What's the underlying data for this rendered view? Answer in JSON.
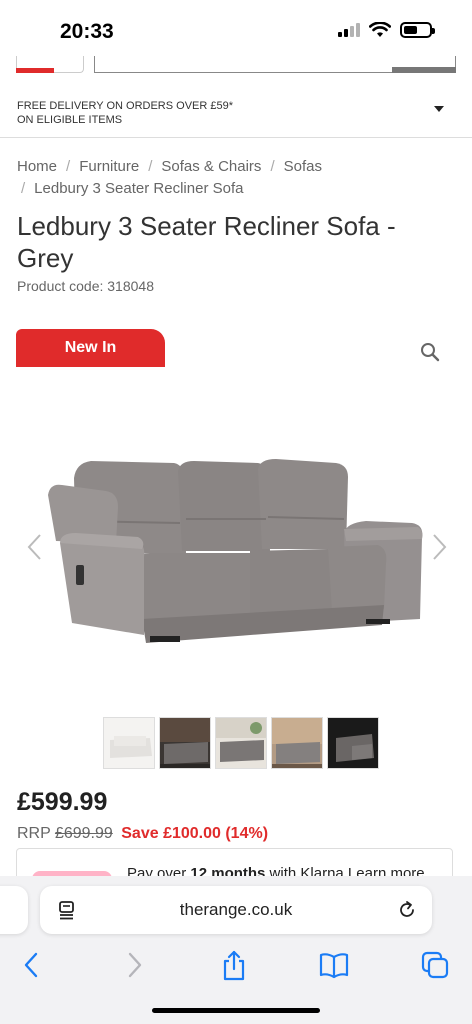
{
  "status_bar": {
    "time": "20:33"
  },
  "header": {},
  "delivery_banner": {
    "line1": "FREE DELIVERY ON ORDERS OVER £59*",
    "line2": "ON ELIGIBLE ITEMS"
  },
  "breadcrumb": {
    "items": [
      "Home",
      "Furniture",
      "Sofas & Chairs",
      "Sofas"
    ],
    "current": "Ledbury 3 Seater Recliner Sofa",
    "separator": "/"
  },
  "product": {
    "title": "Ledbury 3 Seater Recliner Sofa - Grey",
    "code": "Product code: 318048",
    "badge": "New In",
    "price": "£599.99",
    "rrp_label": "RRP",
    "rrp_value": "£699.99",
    "save": "Save £100.00 (14%)"
  },
  "gallery": {
    "thumbnail_count": 5
  },
  "klarna": {
    "prefix": "Pay over ",
    "bold": "12 months",
    "suffix": " with Klarna Learn more"
  },
  "browser": {
    "url": "therange.co.uk"
  },
  "colors": {
    "brand_red": "#e02b2b",
    "sofa_grey": "#8f8a89",
    "ios_blue": "#1b7cf5"
  }
}
